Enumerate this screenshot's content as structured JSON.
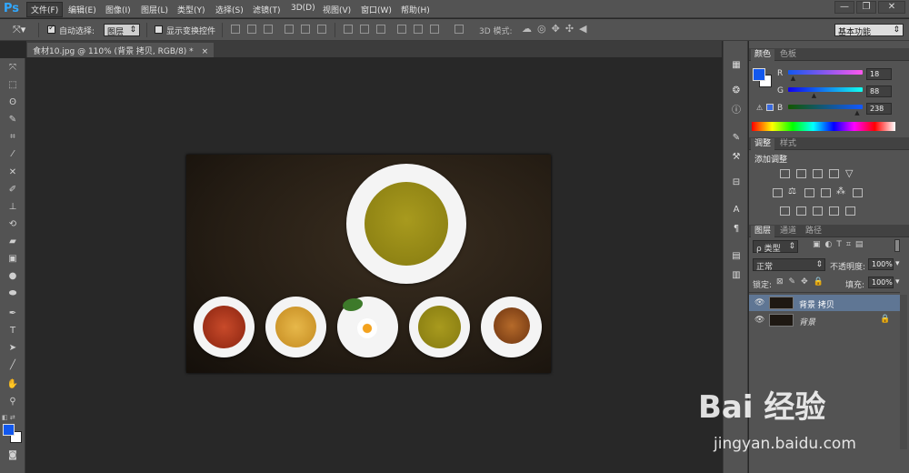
{
  "app": {
    "logo": "Ps"
  },
  "menubar": {
    "items": [
      "文件(F)",
      "编辑(E)",
      "图像(I)",
      "图层(L)",
      "类型(Y)",
      "选择(S)",
      "滤镜(T)",
      "3D(D)",
      "视图(V)",
      "窗口(W)",
      "帮助(H)"
    ],
    "window_buttons": [
      "—",
      "❐",
      "✕"
    ]
  },
  "options": {
    "auto_select_label": "自动选择:",
    "auto_select_value": "图层",
    "show_transform_label": "显示变换控件",
    "mode_3d_label": "3D 模式:",
    "workspace": "基本功能"
  },
  "document": {
    "tab_title": "食材10.jpg @ 110% (背景 拷贝, RGB/8) *",
    "close": "×"
  },
  "color_panel": {
    "tabs": [
      "颜色",
      "色板"
    ],
    "r_label": "R",
    "g_label": "G",
    "b_label": "B",
    "r": "18",
    "g": "88",
    "b": "238",
    "r_fill": 0.07,
    "g_fill": 0.35,
    "b_fill": 0.93,
    "fg_color": "#1258ee",
    "bg_color": "#ffffff"
  },
  "adjustments_panel": {
    "tabs": [
      "调整",
      "样式"
    ],
    "title": "添加调整"
  },
  "layers_panel": {
    "tabs": [
      "图层",
      "通道",
      "路径"
    ],
    "filter_label": "ρ 类型",
    "blend_mode": "正常",
    "opacity_label": "不透明度:",
    "opacity": "100%",
    "lock_label": "锁定:",
    "fill_label": "填充:",
    "fill": "100%",
    "layers": [
      {
        "name": "背景 拷贝",
        "selected": true
      },
      {
        "name": "背景",
        "selected": false,
        "locked": true
      }
    ]
  },
  "watermark": {
    "brand": "Bai 经验",
    "url": "jingyan.baidu.com"
  }
}
